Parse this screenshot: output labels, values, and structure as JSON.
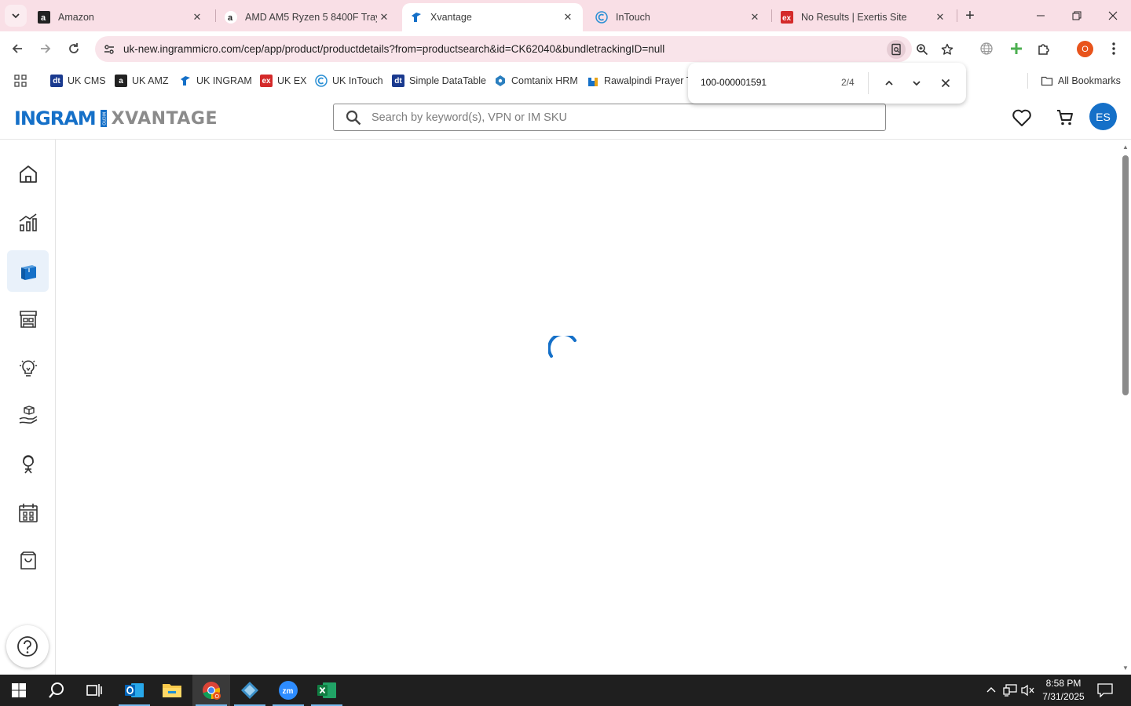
{
  "browser": {
    "tabs": [
      {
        "title": "Amazon",
        "favicon": "amazon-icon"
      },
      {
        "title": "AMD AM5 Ryzen 5 8400F Tray",
        "favicon": "amazon-icon"
      },
      {
        "title": "Xvantage",
        "favicon": "ingram-icon",
        "active": true
      },
      {
        "title": "InTouch",
        "favicon": "intouch-icon"
      },
      {
        "title": "No Results | Exertis Site",
        "favicon": "exertis-icon"
      }
    ],
    "url": "uk-new.ingrammicro.com/cep/app/product/productdetails?from=productsearch&id=CK62040&bundletrackingID=null",
    "profile_initial": "O",
    "bookmarks": [
      {
        "label": "UK CMS",
        "icon": "datatable-icon",
        "color": "#1a3a8f"
      },
      {
        "label": "UK AMZ",
        "icon": "amazon-icon",
        "color": "#222222"
      },
      {
        "label": "UK INGRAM",
        "icon": "ingram-icon",
        "color": "#1570c8"
      },
      {
        "label": "UK EX",
        "icon": "exertis-icon",
        "color": "#d42a2a"
      },
      {
        "label": "UK InTouch",
        "icon": "intouch-icon",
        "color": "#2a8fd4"
      },
      {
        "label": "Simple DataTable",
        "icon": "datatable-icon",
        "color": "#1a3a8f"
      },
      {
        "label": "Comtanix HRM",
        "icon": "comtanix-icon",
        "color": "#2b7fbf"
      },
      {
        "label": "Rawalpindi Prayer Ti",
        "icon": "prayer-icon",
        "color": "#1570c8"
      }
    ],
    "all_bookmarks": "All Bookmarks"
  },
  "find": {
    "query": "100-000001591",
    "count": "2/4"
  },
  "app": {
    "logo_ingram": "INGRAM",
    "logo_micro": "MICRO",
    "logo_xvantage": "XVANTAGE",
    "search_placeholder": "Search by keyword(s), VPN or IM SKU",
    "avatar_initials": "ES",
    "accent": "#1570c8",
    "nav": [
      {
        "name": "home",
        "icon": "home-icon"
      },
      {
        "name": "analytics",
        "icon": "bar-chart-icon"
      },
      {
        "name": "products",
        "icon": "box-icon",
        "active": true
      },
      {
        "name": "store",
        "icon": "store-icon"
      },
      {
        "name": "insights",
        "icon": "lightbulb-icon"
      },
      {
        "name": "services",
        "icon": "hand-box-icon"
      },
      {
        "name": "support",
        "icon": "headset-icon"
      },
      {
        "name": "calendar",
        "icon": "calendar-icon"
      },
      {
        "name": "orders",
        "icon": "bag-icon"
      }
    ]
  },
  "taskbar": {
    "time": "8:58 PM",
    "date": "7/31/2025",
    "apps": [
      "start",
      "search",
      "task-view",
      "outlook",
      "file-explorer",
      "chrome",
      "app-diamond",
      "zoom",
      "excel"
    ]
  }
}
